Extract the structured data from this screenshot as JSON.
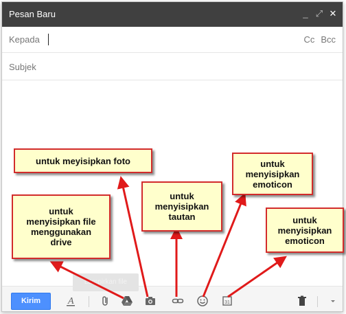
{
  "window": {
    "title": "Pesan Baru",
    "controls": {
      "minimize": "_",
      "expand": "⤢",
      "close": "✕"
    }
  },
  "compose": {
    "to_label": "Kepada",
    "cc": "Cc",
    "bcc": "Bcc",
    "subject_placeholder": "Subjek"
  },
  "toolbar": {
    "send_label": "Kirim",
    "tooltip": "Lampirkan file",
    "icons": {
      "formatting": "formatting-icon",
      "attach": "paperclip-icon",
      "drive": "drive-icon",
      "photo": "camera-icon",
      "link": "link-icon",
      "emoticon": "smiley-icon",
      "invite": "calendar-icon",
      "discard": "trash-icon",
      "more": "chevron-down-icon"
    },
    "calendar_day": "31"
  },
  "annotations": {
    "photo": "untuk meyisipkan foto",
    "drive": "untuk\nmenyisipkan file\nmenggunakan\ndrive",
    "link": "untuk\nmenyisipkan\ntautan",
    "emoticon_top": "untuk\nmenyisipkan\nemoticon",
    "emoticon_right": "untuk\nmenyisipkan\nemoticon"
  },
  "colors": {
    "titlebar": "#404040",
    "send_button": "#4d90fe",
    "callout_fill": "#ffffcc",
    "callout_border": "#d22b2b",
    "arrow": "#e01a1a"
  }
}
